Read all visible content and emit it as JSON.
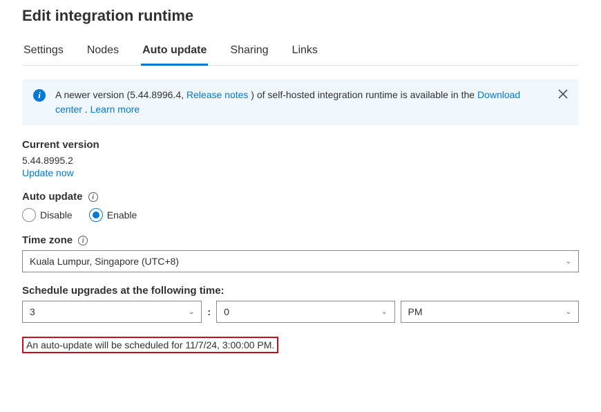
{
  "title": "Edit integration runtime",
  "tabs": [
    {
      "label": "Settings",
      "active": false
    },
    {
      "label": "Nodes",
      "active": false
    },
    {
      "label": "Auto update",
      "active": true
    },
    {
      "label": "Sharing",
      "active": false
    },
    {
      "label": "Links",
      "active": false
    }
  ],
  "banner": {
    "text_pre": "A newer version (5.44.8996.4, ",
    "release_notes": "Release notes",
    "text_mid": " ) of self-hosted integration runtime is available in the ",
    "download_center": "Download center",
    "period": " . ",
    "learn_more": "Learn more"
  },
  "current_version": {
    "label": "Current version",
    "value": "5.44.8995.2",
    "update_now": "Update now"
  },
  "auto_update": {
    "label": "Auto update",
    "disable": "Disable",
    "enable": "Enable",
    "selected": "enable"
  },
  "time_zone": {
    "label": "Time zone",
    "value": "Kuala Lumpur, Singapore (UTC+8)"
  },
  "schedule": {
    "label": "Schedule upgrades at the following time:",
    "hour": "3",
    "minute": "0",
    "ampm": "PM"
  },
  "scheduled_message": "An auto-update will be scheduled for 11/7/24, 3:00:00 PM."
}
